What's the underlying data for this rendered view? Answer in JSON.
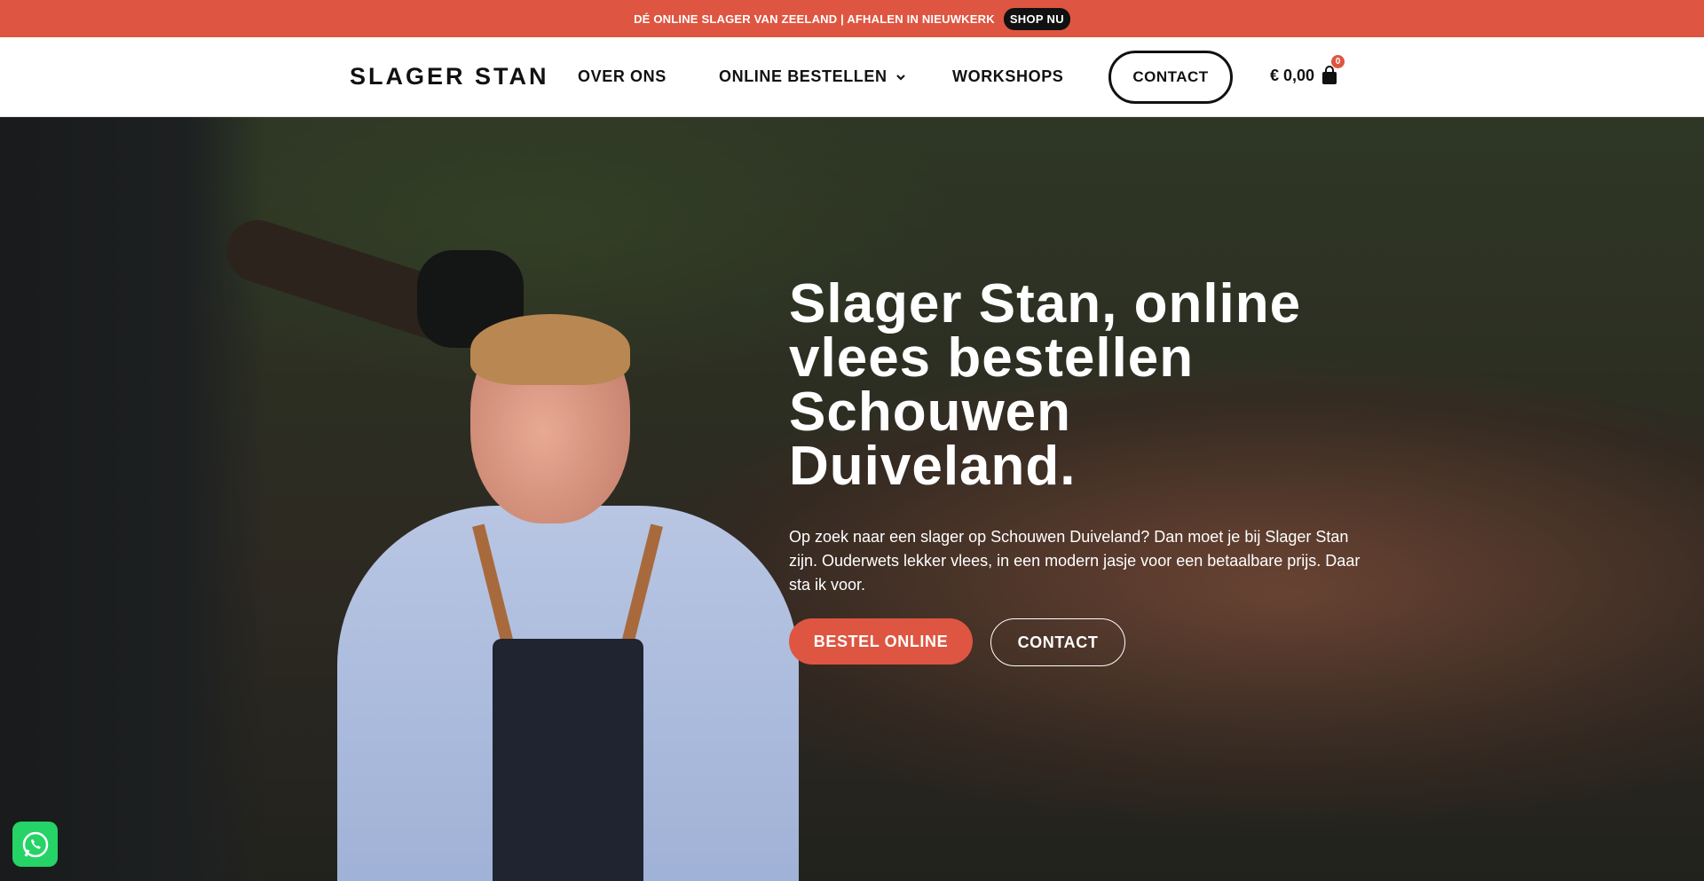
{
  "announcement": {
    "text": "DÉ ONLINE SLAGER VAN ZEELAND | AFHALEN IN NIEUWKERK",
    "button": "SHOP NU"
  },
  "header": {
    "logo": "SLAGER STAN",
    "nav": [
      {
        "label": "OVER ONS"
      },
      {
        "label": "ONLINE BESTELLEN"
      },
      {
        "label": "WORKSHOPS"
      }
    ],
    "contact_button": "CONTACT",
    "cart": {
      "total": "€ 0,00",
      "count": "0"
    }
  },
  "hero": {
    "title_lines": [
      "Slager Stan, online",
      "vlees bestellen",
      "Schouwen",
      "Duiveland."
    ],
    "text": "Op zoek naar een slager op Schouwen Duiveland? Dan moet je bij Slager Stan zijn. Ouderwets lekker vlees, in een modern jasje voor een betaalbare prijs. Daar sta ik voor.",
    "primary_button": "BESTEL ONLINE",
    "secondary_button": "CONTACT"
  },
  "colors": {
    "accent": "#de5641",
    "whatsapp": "#25d366"
  },
  "icons": {
    "dropdown": "chevron-down-icon",
    "cart": "shopping-bag-icon",
    "chat": "whatsapp-icon"
  }
}
